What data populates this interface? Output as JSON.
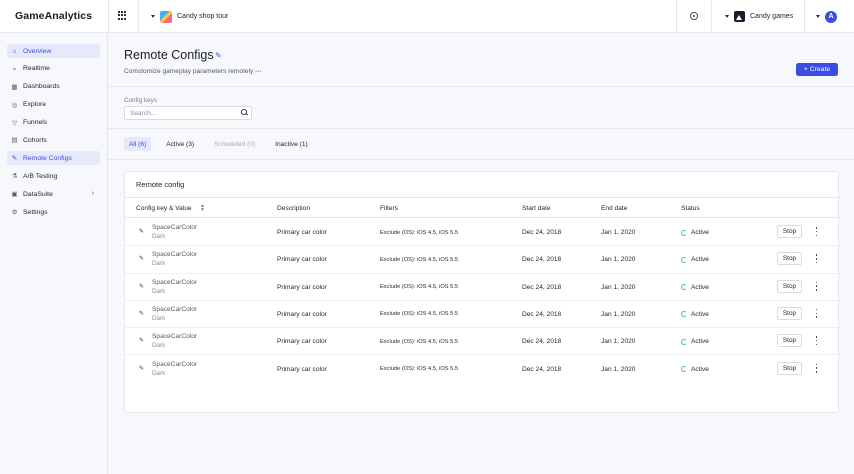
{
  "header": {
    "logo": "GameAnalytics",
    "game": "Candy shop tour",
    "studio": "Candy games",
    "avatar_initial": "A",
    "icons": [
      "apps-grid-icon",
      "settings-gear-icon",
      "studio-icon"
    ]
  },
  "sidebar": {
    "items": [
      {
        "label": "Overview",
        "icon": "⌂",
        "active": true
      },
      {
        "label": "Realtime",
        "icon": "⌁",
        "active": false
      },
      {
        "label": "Dashboards",
        "icon": "▦",
        "active": false
      },
      {
        "label": "Explore",
        "icon": "◎",
        "active": false
      },
      {
        "label": "Funnels",
        "icon": "▽",
        "active": false
      },
      {
        "label": "Cohorts",
        "icon": "▤",
        "active": false
      },
      {
        "label": "Remote Configs",
        "icon": "✎",
        "active": true
      },
      {
        "label": "A/B Testing",
        "icon": "⚗",
        "active": false
      },
      {
        "label": "DataSuite",
        "icon": "▣",
        "active": false,
        "expandable": true
      },
      {
        "label": "Settings",
        "icon": "⚙",
        "active": false
      }
    ]
  },
  "page": {
    "title": "Remote Configs",
    "subtitle": "Comstomize gameplay parameters remotely",
    "subtitle_more": "•••",
    "create_label": "+ Create",
    "search_label": "Config keys",
    "search_placeholder": "Search...",
    "tabs": [
      {
        "label": "All (6)",
        "state": "active"
      },
      {
        "label": "Active (3)",
        "state": "normal"
      },
      {
        "label": "Scheduled (0)",
        "state": "disabled"
      },
      {
        "label": "Inactive (1)",
        "state": "normal"
      }
    ]
  },
  "table": {
    "title": "Remote config",
    "columns": [
      "Config key & Value",
      "Description",
      "Filters",
      "Start date",
      "End date",
      "Status"
    ],
    "rows": [
      {
        "key": "SpaceCarColor",
        "value": "Dark",
        "description": "Primary car color",
        "filters": "Exclude (OS): iOS 4.5, iOS 5.5",
        "start": "Dec 24, 2018",
        "end": "Jan 1, 2020",
        "status": "Active",
        "action": "Stop"
      },
      {
        "key": "SpaceCarColor",
        "value": "Dark",
        "description": "Primary car color",
        "filters": "Exclude (OS): iOS 4.5, iOS 5.5",
        "start": "Dec 24, 2018",
        "end": "Jan 1, 2020",
        "status": "Active",
        "action": "Stop"
      },
      {
        "key": "SpaceCarColor",
        "value": "Dark",
        "description": "Primary car color",
        "filters": "Exclude (OS): iOS 4.5, iOS 5.5",
        "start": "Dec 24, 2018",
        "end": "Jan 1, 2020",
        "status": "Active",
        "action": "Stop"
      },
      {
        "key": "SpaceCarColor",
        "value": "Dark",
        "description": "Primary car color",
        "filters": "Exclude (OS): iOS 4.5, iOS 5.5",
        "start": "Dec 24, 2018",
        "end": "Jan 1, 2020",
        "status": "Active",
        "action": "Stop"
      },
      {
        "key": "SpaceCarColor",
        "value": "Dark",
        "description": "Primary car color",
        "filters": "Exclude (OS): iOS 4.5, iOS 5.5",
        "start": "Dec 24, 2018",
        "end": "Jan 1, 2020",
        "status": "Active",
        "action": "Stop"
      },
      {
        "key": "SpaceCarColor",
        "value": "Dark",
        "description": "Primary car color",
        "filters": "Exclude (OS): iOS 4.5, iOS 5.5",
        "start": "Dec 24, 2018",
        "end": "Jan 1, 2020",
        "status": "Active",
        "action": "Stop"
      }
    ]
  },
  "colors": {
    "accent": "#3b4de0",
    "accent_bg": "#e6e8fb",
    "status_active": "#4cc38a",
    "border": "#e6e8ee"
  }
}
